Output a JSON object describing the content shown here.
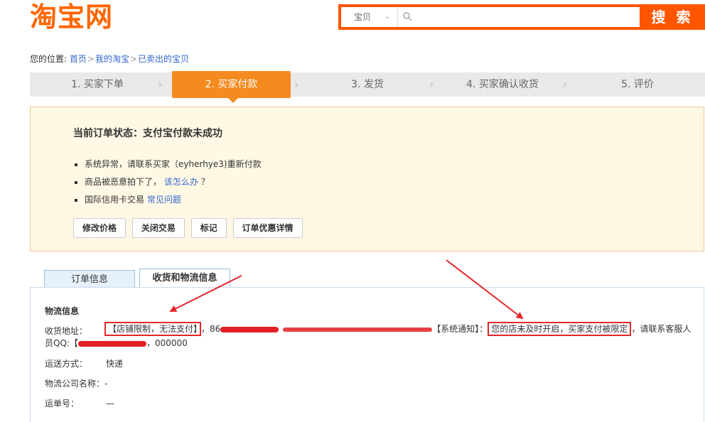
{
  "header": {
    "logo": "淘宝网",
    "search_category": "宝贝",
    "search_placeholder": "",
    "search_button": "搜 索"
  },
  "breadcrumb": {
    "prefix": "您的位置:",
    "items": [
      "首页",
      "我的淘宝",
      "已卖出的宝贝"
    ]
  },
  "steps": [
    "1. 买家下单",
    "2. 买家付款",
    "3. 发货",
    "4. 买家确认收货",
    "5. 评价"
  ],
  "status": {
    "title": "当前订单状态：支付宝付款未成功",
    "bullet1": "系统异常，请联系买家（eyherhye3)重新付款",
    "bullet2_text": "商品被恶意拍下了，",
    "bullet2_link": "该怎么办",
    "bullet2_tail": "？",
    "bullet3_text": "国际信用卡交易 ",
    "bullet3_link": "常见问题",
    "actions": [
      "修改价格",
      "关闭交易",
      "标记",
      "订单优惠详情"
    ]
  },
  "tabs": [
    "订单信息",
    "收货和物流信息"
  ],
  "logistics": {
    "title": "物流信息",
    "address_label": "收货地址：",
    "addr_boxed1": "【店铺限制，无法支付】",
    "addr_part1": "，86",
    "addr_part2": "【系统通知】：",
    "addr_boxed2": "您的店未及时开启，买家支付被限定",
    "addr_part3": "，请联系客服人",
    "addr_line2_a": "员QQ:【",
    "addr_line2_b": "，000000",
    "shipping_label": "运送方式：",
    "shipping_value": "快递",
    "company_label": "物流公司名称：",
    "company_value": "-",
    "tracking_label": "运单号：",
    "tracking_value": "—"
  },
  "colors": {
    "brand_orange": "#ff5500",
    "step_active": "#f58a1f",
    "highlight_red": "#e3262a",
    "link": "#3366cc"
  }
}
